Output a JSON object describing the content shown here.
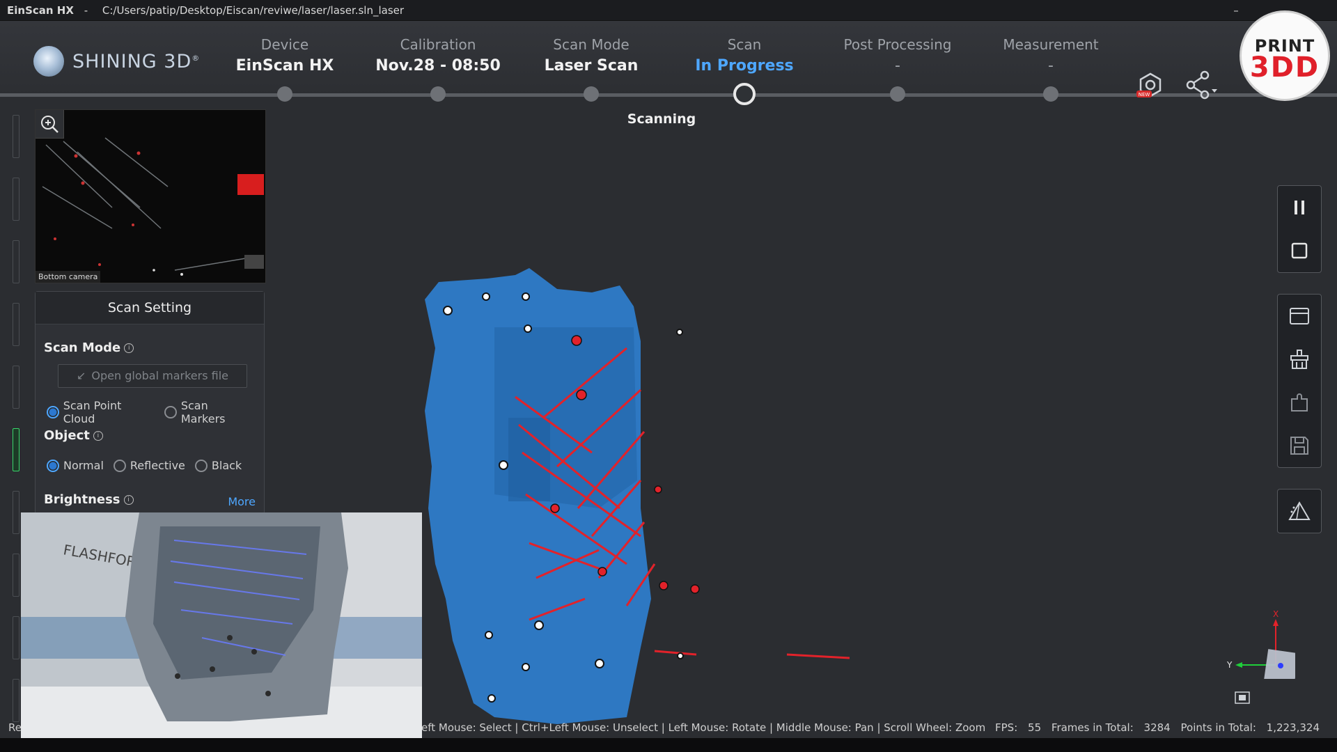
{
  "window": {
    "app_name": "EinScan HX",
    "separator": "-",
    "path": "C:/Users/patip/Desktop/Eiscan/reviwe/laser/laser.sln_laser",
    "minimize": "–"
  },
  "brand": {
    "name": "SHINING 3D",
    "mark": "®"
  },
  "steps": [
    {
      "label": "Device",
      "value": "EinScan HX"
    },
    {
      "label": "Calibration",
      "value": "Nov.28 - 08:50"
    },
    {
      "label": "Scan Mode",
      "value": "Laser Scan"
    },
    {
      "label": "Scan",
      "value": "In Progress"
    },
    {
      "label": "Post Processing",
      "value": "-"
    },
    {
      "label": "Measurement",
      "value": "-"
    }
  ],
  "active_step_index": 3,
  "badge": {
    "line1": "PRINT",
    "line2": "3DD"
  },
  "new_tag": "NEW",
  "status_title": "Scanning",
  "camera": {
    "label": "Bottom camera"
  },
  "scan_setting": {
    "title": "Scan Setting",
    "scan_mode_label": "Scan Mode",
    "open_markers_button": "Open global markers file",
    "scan_mode_options": [
      "Scan Point Cloud",
      "Scan Markers"
    ],
    "scan_mode_selected": "Scan Point Cloud",
    "object_label": "Object",
    "object_options": [
      "Normal",
      "Reflective",
      "Black"
    ],
    "object_selected": "Normal",
    "brightness_label": "Brightness",
    "more_link": "More",
    "info_glyph": "i"
  },
  "video_overlay": {
    "brand_text": "FLASHFORGE"
  },
  "axis": {
    "x_label": "X",
    "y_label": "Y"
  },
  "status": {
    "left_fragment": "Re",
    "hints": "eft Mouse: Select | Ctrl+Left Mouse: Unselect | Left Mouse: Rotate | Middle Mouse: Pan | Scroll Wheel: Zoom",
    "fps_label": "FPS:",
    "fps": "55",
    "frames_label": "Frames in Total:",
    "frames": "3284",
    "points_label": "Points in Total:",
    "points": "1,223,324"
  },
  "colors": {
    "accent": "#4ea7ff",
    "scan_blue": "#2e78c2",
    "laser_red": "#e2222a",
    "active_green": "#38d86b"
  },
  "icons": {
    "top": [
      "new-feature-icon",
      "share-icon"
    ],
    "right_toolbar": [
      "pause-icon",
      "stop-icon",
      "window-icon",
      "clean-icon",
      "plugin-icon",
      "save-icon",
      "mesh-icon"
    ],
    "camera": "zoom-in-icon",
    "fit_view": "fit-view-icon"
  }
}
